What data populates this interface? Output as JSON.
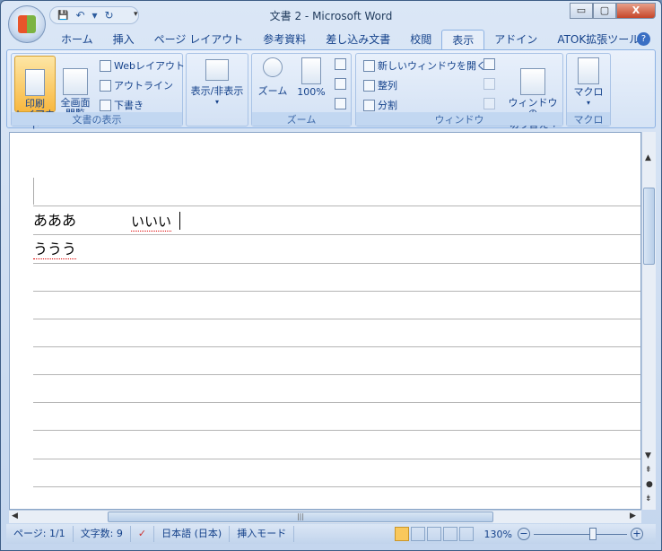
{
  "window": {
    "title": "文書 2 - Microsoft Word",
    "minimize": "▭",
    "maximize": "▢",
    "close": "X"
  },
  "qat": {
    "save": "💾",
    "undo": "↶",
    "undo_dropdown": "▾",
    "redo": "↻",
    "customize": "▾"
  },
  "tabs": [
    "ホーム",
    "挿入",
    "ページ レイアウト",
    "参考資料",
    "差し込み文書",
    "校閲",
    "表示",
    "アドイン",
    "ATOK拡張ツール"
  ],
  "active_tab": "表示",
  "help": "?",
  "ribbon": {
    "doc_view": {
      "label": "文書の表示",
      "print_layout": "印刷\nレイアウト",
      "full_screen": "全画面\n閲覧",
      "web_layout": "Webレイアウト",
      "outline": "アウトライン",
      "draft": "下書き"
    },
    "show_hide": {
      "label": "表示/非表示",
      "arrow": "▾"
    },
    "zoom": {
      "label": "ズーム",
      "zoom": "ズーム",
      "hundred": "100%"
    },
    "window": {
      "label": "ウィンドウ",
      "new_window": "新しいウィンドウを開く",
      "arrange": "整列",
      "split": "分割",
      "switch": "ウィンドウの\n切り替え ▾"
    },
    "macro": {
      "label": "マクロ",
      "macro": "マクロ",
      "arrow": "▾"
    }
  },
  "document": {
    "line1a": "あああ",
    "line1b": "いいい",
    "line2": "ううう"
  },
  "status": {
    "page": "ページ: 1/1",
    "chars": "文字数: 9",
    "language": "日本語 (日本)",
    "mode": "挿入モード",
    "zoom": "130%"
  }
}
